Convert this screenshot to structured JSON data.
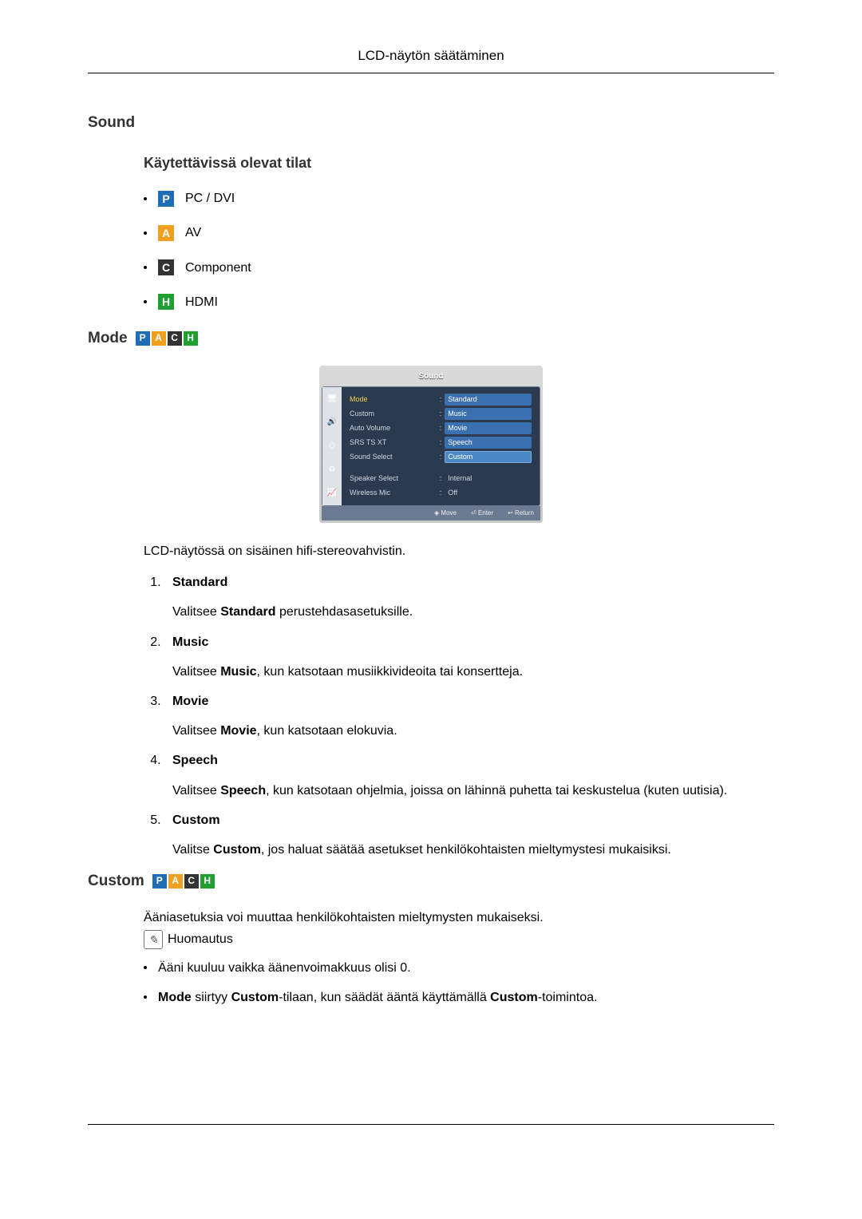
{
  "header": {
    "title": "LCD-näytön säätäminen"
  },
  "sound": {
    "heading": "Sound",
    "modes_heading": "Käytettävissä olevat tilat",
    "modes": [
      {
        "icon": "P",
        "cls": "ic-p",
        "label": "PC / DVI"
      },
      {
        "icon": "A",
        "cls": "ic-a",
        "label": "AV"
      },
      {
        "icon": "C",
        "cls": "ic-c",
        "label": "Component"
      },
      {
        "icon": "H",
        "cls": "ic-h",
        "label": "HDMI"
      }
    ]
  },
  "mode_section": {
    "title": "Mode",
    "icons": [
      "P",
      "A",
      "C",
      "H"
    ],
    "osd": {
      "title": "Sound",
      "left": [
        "Mode",
        "Custom",
        "Auto Volume",
        "SRS TS XT",
        "Sound Select",
        "Speaker Select",
        "Wireless Mic"
      ],
      "right": [
        "Standard",
        "Music",
        "Movie",
        "Speech",
        "Custom",
        "Internal",
        "Off"
      ],
      "hint_move": "Move",
      "hint_enter": "Enter",
      "hint_return": "Return"
    },
    "intro": "LCD-näytössä on sisäinen hifi-stereovahvistin.",
    "options": [
      {
        "title": "Standard",
        "desc_pre": "Valitsee ",
        "desc_bold": "Standard",
        "desc_post": " perustehdasasetuksille."
      },
      {
        "title": "Music",
        "desc_pre": "Valitsee ",
        "desc_bold": "Music",
        "desc_post": ", kun katsotaan musiikkivideoita tai konsertteja."
      },
      {
        "title": "Movie",
        "desc_pre": "Valitsee ",
        "desc_bold": "Movie",
        "desc_post": ", kun katsotaan elokuvia."
      },
      {
        "title": "Speech",
        "desc_pre": "Valitsee ",
        "desc_bold": "Speech",
        "desc_post": ", kun katsotaan ohjelmia, joissa on lähinnä puhetta tai keskustelua (kuten uutisia)."
      },
      {
        "title": "Custom",
        "desc_pre": "Valitse ",
        "desc_bold": "Custom",
        "desc_post": ", jos haluat säätää asetukset henkilökohtaisten mieltymystesi mukaisiksi."
      }
    ]
  },
  "custom_section": {
    "title": "Custom",
    "icons": [
      "P",
      "A",
      "C",
      "H"
    ],
    "intro": "Ääniasetuksia voi muuttaa henkilökohtaisten mieltymysten mukaiseksi.",
    "note_label": "Huomautus",
    "notes": [
      {
        "text": "Ääni kuuluu vaikka äänenvoimakkuus olisi 0."
      },
      {
        "pre": "",
        "b1": "Mode",
        "mid1": " siirtyy ",
        "b2": "Custom",
        "mid2": "-tilaan, kun säädät ääntä käyttämällä ",
        "b3": "Custom",
        "post": "-toimintoa."
      }
    ]
  }
}
